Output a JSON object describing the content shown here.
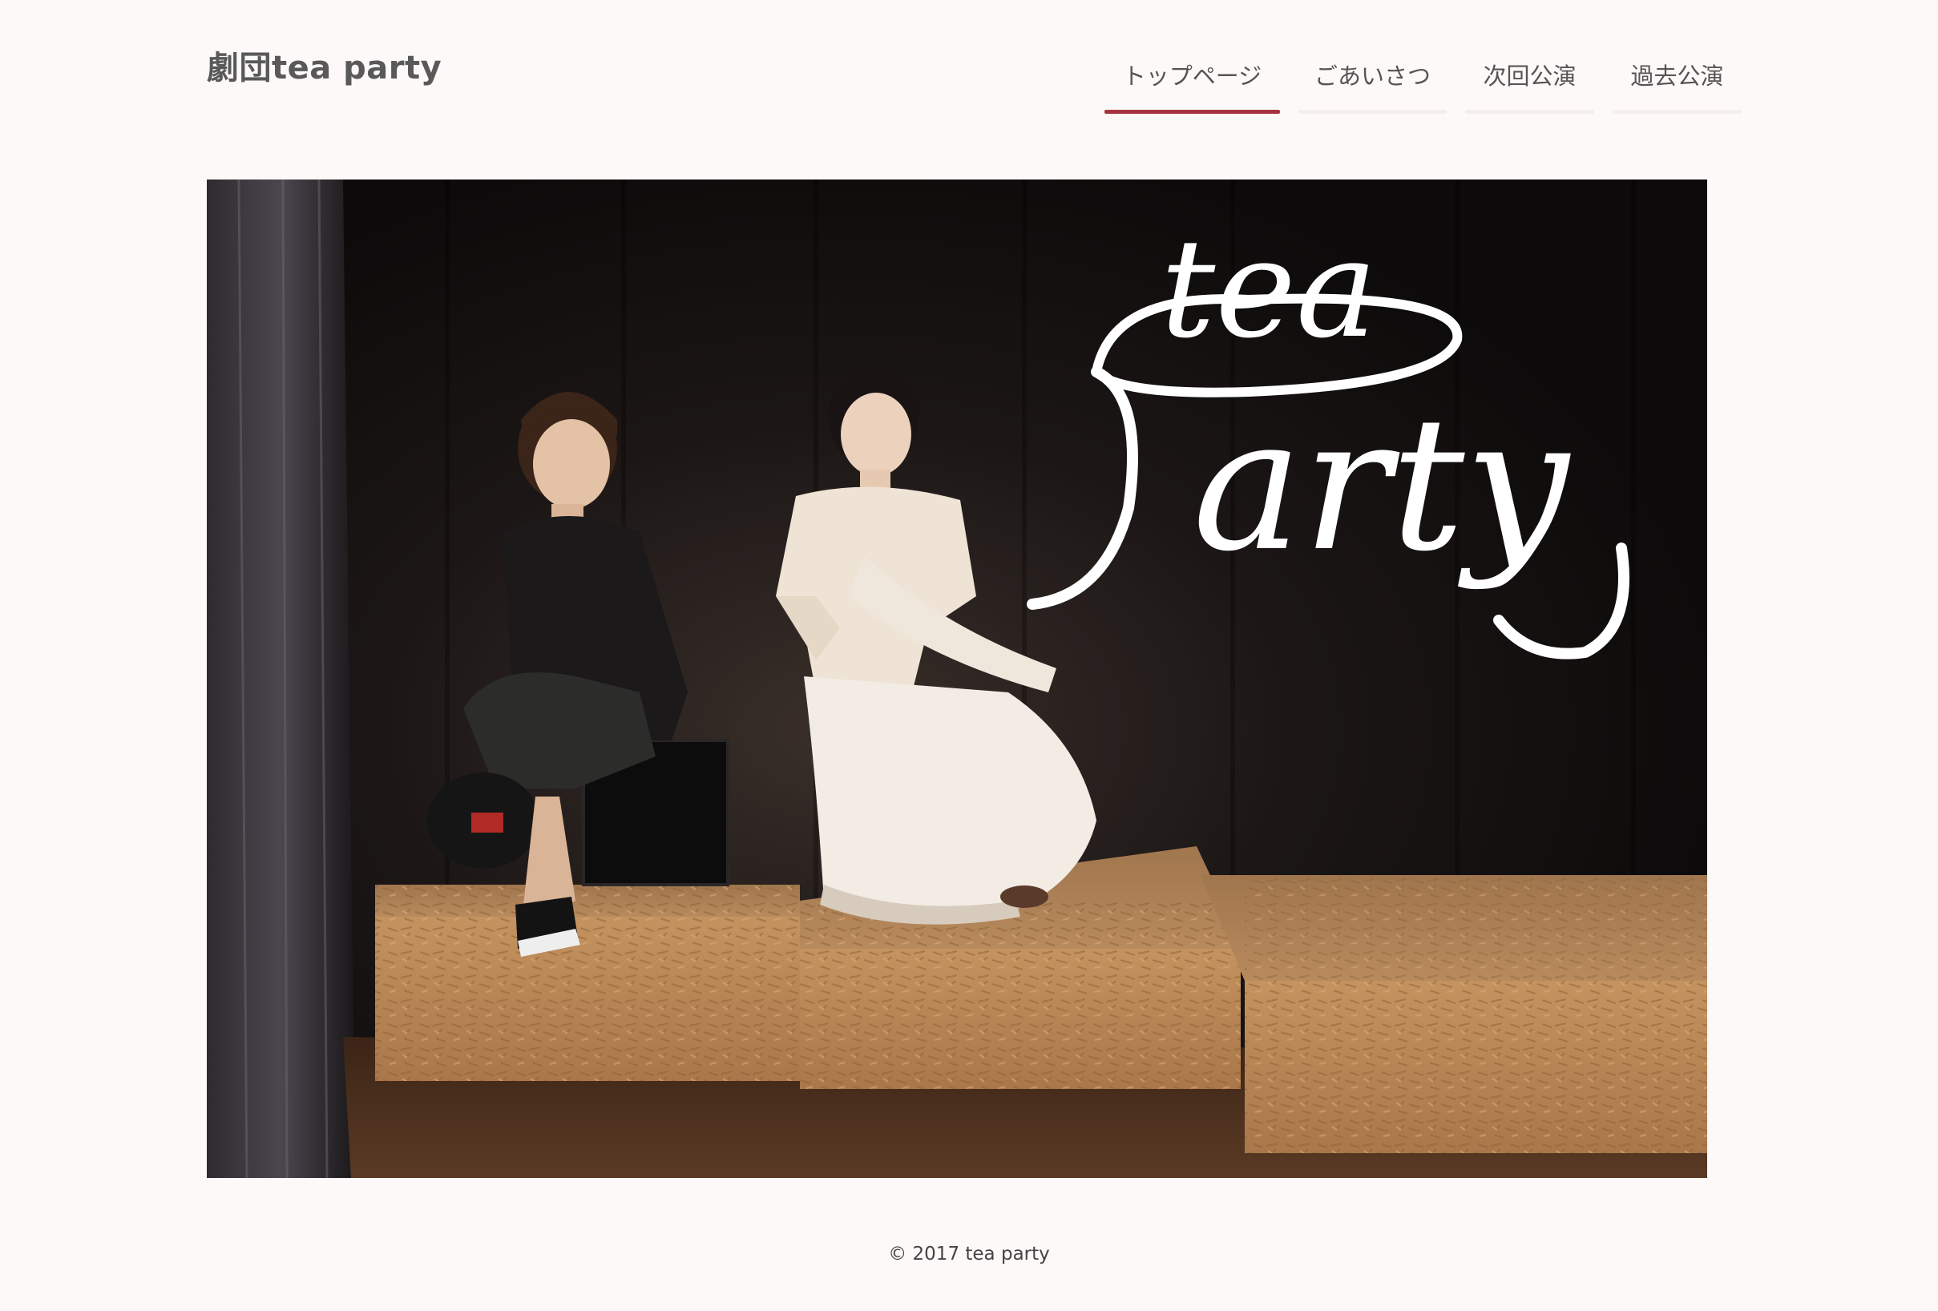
{
  "site": {
    "title": "劇団tea party"
  },
  "nav": {
    "items": [
      {
        "label": "トップページ",
        "active": true
      },
      {
        "label": "ごあいさつ",
        "active": false
      },
      {
        "label": "次回公演",
        "active": false
      },
      {
        "label": "過去公演",
        "active": false
      }
    ]
  },
  "hero": {
    "logo_text": "tea party"
  },
  "footer": {
    "copyright": "© 2017 tea party"
  },
  "colors": {
    "accent": "#a6343e",
    "background": "#fdf9f8"
  }
}
